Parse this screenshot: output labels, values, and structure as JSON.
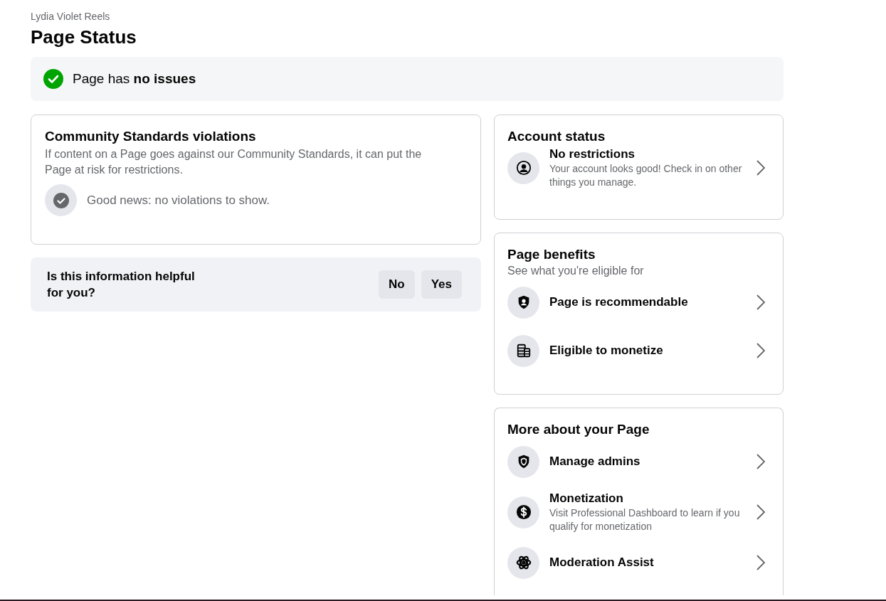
{
  "page_name": "Lydia Violet Reels",
  "title": "Page Status",
  "status_banner": {
    "text": "Page has **no issues**"
  },
  "community_standards": {
    "title": "Community Standards violations",
    "description": "If content on a Page goes against our Community Standards, it can put the Page at risk for restrictions.",
    "message": "Good news: no violations to show."
  },
  "feedback": {
    "question": "Is this information helpful for you?",
    "buttons": [
      "No",
      "Yes"
    ]
  },
  "account_status": {
    "title": "Account status",
    "items": [
      {
        "title": "No restrictions",
        "description": "Your account looks good! Check in on other things you manage."
      }
    ]
  },
  "page_benefits": {
    "title": "Page benefits",
    "subtitle": "See what you're eligible for",
    "items": [
      {
        "title": "Page is recommendable"
      },
      {
        "title": "Eligible to monetize"
      }
    ]
  },
  "more_about": {
    "title": "More about your Page",
    "items": [
      {
        "title": "Manage admins"
      },
      {
        "title": "Monetization",
        "description": "Visit Professional Dashboard to learn if you qualify for monetization"
      },
      {
        "title": "Moderation Assist"
      }
    ]
  }
}
